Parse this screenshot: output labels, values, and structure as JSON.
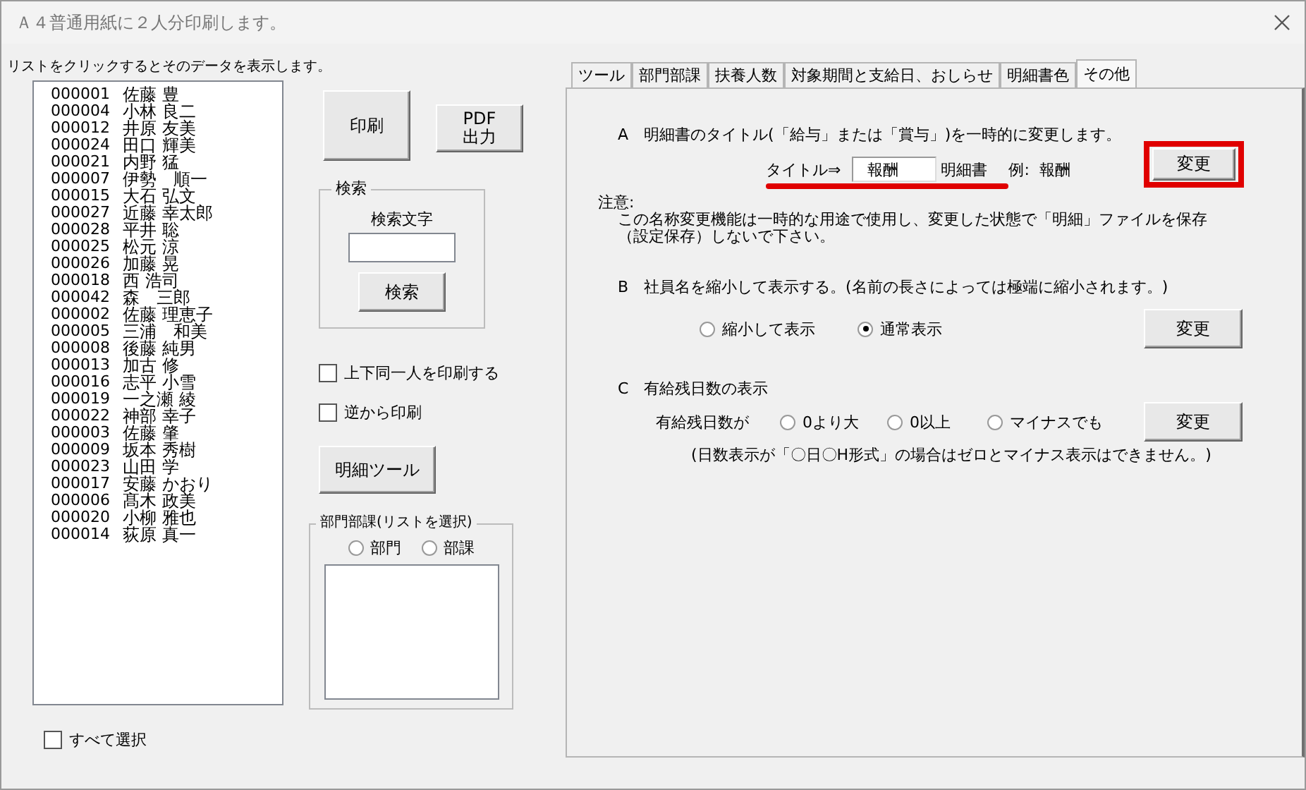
{
  "window": {
    "title": "Ａ４普通用紙に２人分印刷します。"
  },
  "list_hint": "リストをクリックするとそのデータを表示します。",
  "employees": [
    {
      "code": "000001",
      "name": "佐藤 豊"
    },
    {
      "code": "000004",
      "name": "小林 良二"
    },
    {
      "code": "000012",
      "name": "井原 友美"
    },
    {
      "code": "000024",
      "name": "田口 輝美"
    },
    {
      "code": "000021",
      "name": "内野 猛"
    },
    {
      "code": "000007",
      "name": "伊勢　順一"
    },
    {
      "code": "000015",
      "name": "大石 弘文"
    },
    {
      "code": "000027",
      "name": "近藤 幸太郎"
    },
    {
      "code": "000028",
      "name": "平井 聡"
    },
    {
      "code": "000025",
      "name": "松元 涼"
    },
    {
      "code": "000026",
      "name": "加藤 晃"
    },
    {
      "code": "000018",
      "name": "西 浩司"
    },
    {
      "code": "000042",
      "name": "森　三郎"
    },
    {
      "code": "000002",
      "name": "佐藤 理恵子"
    },
    {
      "code": "000005",
      "name": "三浦　和美"
    },
    {
      "code": "000008",
      "name": "後藤 純男"
    },
    {
      "code": "000013",
      "name": "加古 修"
    },
    {
      "code": "000016",
      "name": "志平 小雪"
    },
    {
      "code": "000019",
      "name": "一之瀬 綾"
    },
    {
      "code": "000022",
      "name": "神部 幸子"
    },
    {
      "code": "000003",
      "name": "佐藤 肇"
    },
    {
      "code": "000009",
      "name": "坂本 秀樹"
    },
    {
      "code": "000023",
      "name": "山田 学"
    },
    {
      "code": "000017",
      "name": "安藤 かおり"
    },
    {
      "code": "000006",
      "name": "髙木 政美"
    },
    {
      "code": "000020",
      "name": "小柳 雅也"
    },
    {
      "code": "000014",
      "name": "荻原 真一"
    }
  ],
  "select_all": {
    "label": "すべて選択",
    "checked": false
  },
  "print_button": "印刷",
  "pdf_button": "PDF\n出力",
  "search": {
    "group": "検索",
    "field_label": "検索文字",
    "button": "検索"
  },
  "options": [
    {
      "label": "上下同一人を印刷する",
      "checked": false
    },
    {
      "label": "逆から印刷",
      "checked": false
    }
  ],
  "tool_button": "明細ツール",
  "dept_group": {
    "label": "部門部課(リストを選択)",
    "radios": [
      {
        "label": "部門",
        "selected": false
      },
      {
        "label": "部課",
        "selected": false
      }
    ]
  },
  "tabs": [
    {
      "label": "ツール",
      "selected": false
    },
    {
      "label": "部門部課",
      "selected": false
    },
    {
      "label": "扶養人数",
      "selected": false
    },
    {
      "label": "対象期間と支給日、おしらせ",
      "selected": false
    },
    {
      "label": "明細書色",
      "selected": false
    },
    {
      "label": "その他",
      "selected": true
    }
  ],
  "section_a": {
    "heading": "A　明細書のタイトル(「給与」または「賞与」)を一時的に変更します。",
    "title_label": "タイトル⇒",
    "title_value": "報酬",
    "suffix": "明細書",
    "example": "例:  報酬",
    "button": "変更",
    "note_label": "注意:",
    "note_lines": [
      "この名称変更機能は一時的な用途で使用し、変更した状態で「明細」ファイルを保存",
      "（設定保存）しないで下さい。"
    ]
  },
  "section_b": {
    "heading": "B　社員名を縮小して表示する。(名前の長さによっては極端に縮小されます。)",
    "radios": [
      {
        "label": "縮小して表示",
        "selected": false
      },
      {
        "label": "通常表示",
        "selected": true
      }
    ],
    "button": "変更"
  },
  "section_c": {
    "heading": "C　有給残日数の表示",
    "prompt": "有給残日数が",
    "radios": [
      {
        "label": "0より大",
        "selected": false
      },
      {
        "label": "0以上",
        "selected": false
      },
      {
        "label": "マイナスでも",
        "selected": false
      }
    ],
    "button": "変更",
    "note": "(日数表示が「〇日〇H形式」の場合はゼロとマイナス表示はできません。)"
  }
}
